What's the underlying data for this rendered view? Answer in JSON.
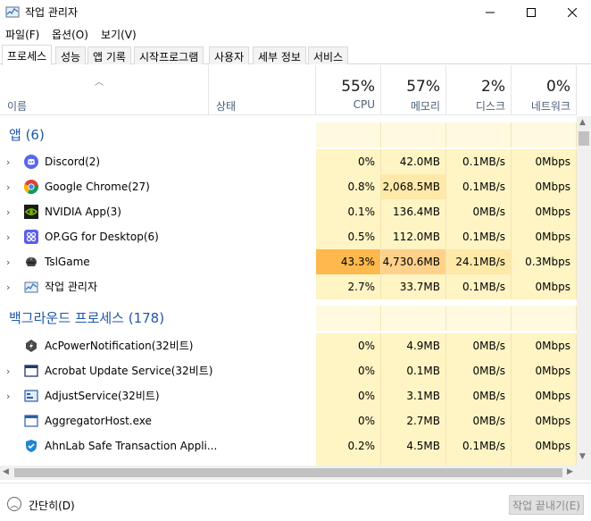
{
  "window": {
    "title": "작업 관리자"
  },
  "menu": [
    "파일(F)",
    "옵션(O)",
    "보기(V)"
  ],
  "tabs": [
    "프로세스",
    "성능",
    "앱 기록",
    "시작프로그램",
    "사용자",
    "세부 정보",
    "서비스"
  ],
  "columns": {
    "name": "이름",
    "status": "상태",
    "cpu": {
      "pct": "55%",
      "label": "CPU"
    },
    "memory": {
      "pct": "57%",
      "label": "메모리"
    },
    "disk": {
      "pct": "2%",
      "label": "디스크"
    },
    "network": {
      "pct": "0%",
      "label": "네트워크"
    }
  },
  "groups": [
    {
      "title": "앱 (6)",
      "rows": [
        {
          "name": "Discord(2)",
          "icon": "discord-icon",
          "cpu": "0%",
          "memory": "42.0MB",
          "disk": "0.1MB/s",
          "network": "0Mbps"
        },
        {
          "name": "Google Chrome(27)",
          "icon": "chrome-icon",
          "cpu": "0.8%",
          "memory": "2,068.5MB",
          "disk": "0.1MB/s",
          "network": "0Mbps"
        },
        {
          "name": "NVIDIA App(3)",
          "icon": "nvidia-icon",
          "cpu": "0.1%",
          "memory": "136.4MB",
          "disk": "0MB/s",
          "network": "0Mbps"
        },
        {
          "name": "OP.GG for Desktop(6)",
          "icon": "opgg-icon",
          "cpu": "0.5%",
          "memory": "112.0MB",
          "disk": "0.1MB/s",
          "network": "0Mbps"
        },
        {
          "name": "TslGame",
          "icon": "tslgame-icon",
          "cpu": "43.3%",
          "memory": "4,730.6MB",
          "disk": "24.1MB/s",
          "network": "0.3Mbps"
        },
        {
          "name": "작업 관리자",
          "icon": "task-manager-icon",
          "cpu": "2.7%",
          "memory": "33.7MB",
          "disk": "0.1MB/s",
          "network": "0Mbps"
        }
      ]
    },
    {
      "title": "백그라운드 프로세스 (178)",
      "rows": [
        {
          "name": "AcPowerNotification(32비트)",
          "icon": "acpower-icon",
          "cpu": "0%",
          "memory": "4.9MB",
          "disk": "0MB/s",
          "network": "0Mbps"
        },
        {
          "name": "Acrobat Update Service(32비트)",
          "icon": "acrobat-service-icon",
          "cpu": "0%",
          "memory": "0.1MB",
          "disk": "0MB/s",
          "network": "0Mbps"
        },
        {
          "name": "AdjustService(32비트)",
          "icon": "adjust-service-icon",
          "cpu": "0%",
          "memory": "3.1MB",
          "disk": "0MB/s",
          "network": "0Mbps"
        },
        {
          "name": "AggregatorHost.exe",
          "icon": "aggregator-icon",
          "cpu": "0%",
          "memory": "2.7MB",
          "disk": "0MB/s",
          "network": "0Mbps"
        },
        {
          "name": "AhnLab Safe Transaction Appli...",
          "icon": "ahnlab-icon",
          "cpu": "0.2%",
          "memory": "4.5MB",
          "disk": "0.1MB/s",
          "network": "0Mbps"
        }
      ]
    }
  ],
  "footer": {
    "fewer_details": "간단히(D)",
    "end_task": "작업 끝내기(E)"
  }
}
